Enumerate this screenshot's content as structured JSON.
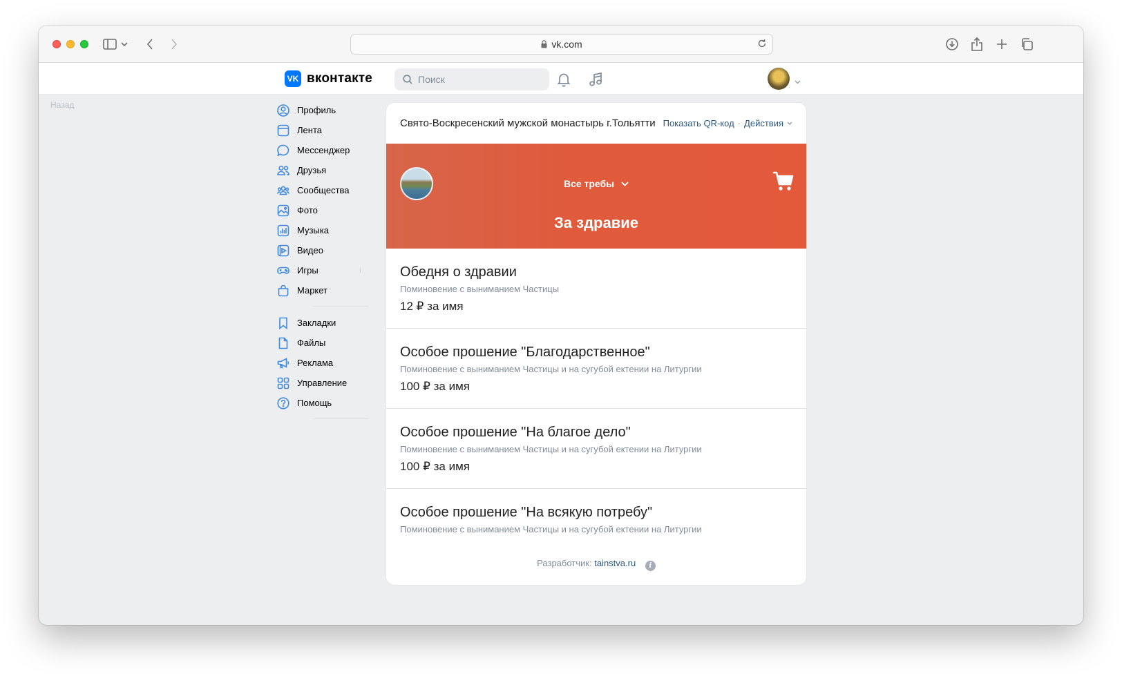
{
  "browser": {
    "url": "vk.com"
  },
  "vk": {
    "logo_mark": "VK",
    "logo_text": "вконтакте",
    "search_placeholder": "Поиск"
  },
  "back_label": "Назад",
  "sidebar": {
    "items": [
      {
        "label": "Профиль",
        "icon": "user-circle-icon"
      },
      {
        "label": "Лента",
        "icon": "newsfeed-icon"
      },
      {
        "label": "Мессенджер",
        "icon": "message-icon"
      },
      {
        "label": "Друзья",
        "icon": "friends-icon"
      },
      {
        "label": "Сообщества",
        "icon": "communities-icon"
      },
      {
        "label": "Фото",
        "icon": "photo-icon"
      },
      {
        "label": "Музыка",
        "icon": "music-icon"
      },
      {
        "label": "Видео",
        "icon": "video-icon"
      },
      {
        "label": "Игры",
        "icon": "gamepad-icon"
      },
      {
        "label": "Маркет",
        "icon": "bag-icon"
      }
    ],
    "items2": [
      {
        "label": "Закладки",
        "icon": "bookmark-icon"
      },
      {
        "label": "Файлы",
        "icon": "file-icon"
      },
      {
        "label": "Реклама",
        "icon": "megaphone-icon"
      },
      {
        "label": "Управление",
        "icon": "grid-icon"
      },
      {
        "label": "Помощь",
        "icon": "help-icon"
      }
    ]
  },
  "card": {
    "title": "Свято-Воскресенский мужской монастырь г.Тольятти",
    "qr_label": "Показать QR-код",
    "separator": "·",
    "actions_label": "Действия",
    "banner": {
      "select_label": "Все требы",
      "title": "За здравие",
      "color": "#e35a3b"
    },
    "items": [
      {
        "title": "Обедня о здравии",
        "desc": "Поминовение с выниманием Частицы",
        "price": "12 ₽ за имя"
      },
      {
        "title": "Особое прошение \"Благодарственное\"",
        "desc": "Поминовение с выниманием Частицы и на сугубой ектении на Литургии",
        "price": "100 ₽ за имя"
      },
      {
        "title": "Особое прошение \"На благое дело\"",
        "desc": "Поминовение с выниманием Частицы и на сугубой ектении на Литургии",
        "price": "100 ₽ за имя"
      },
      {
        "title": "Особое прошение \"На всякую потребу\"",
        "desc": "Поминовение с выниманием Частицы и на сугубой ектении на Литургии",
        "price": ""
      }
    ],
    "footer": {
      "label": "Разработчик:",
      "link": "tainstva.ru",
      "info": "i"
    }
  },
  "colors": {
    "accent": "#0077ff",
    "link": "#2a5885",
    "icon_blue": "#3f8ae0"
  }
}
